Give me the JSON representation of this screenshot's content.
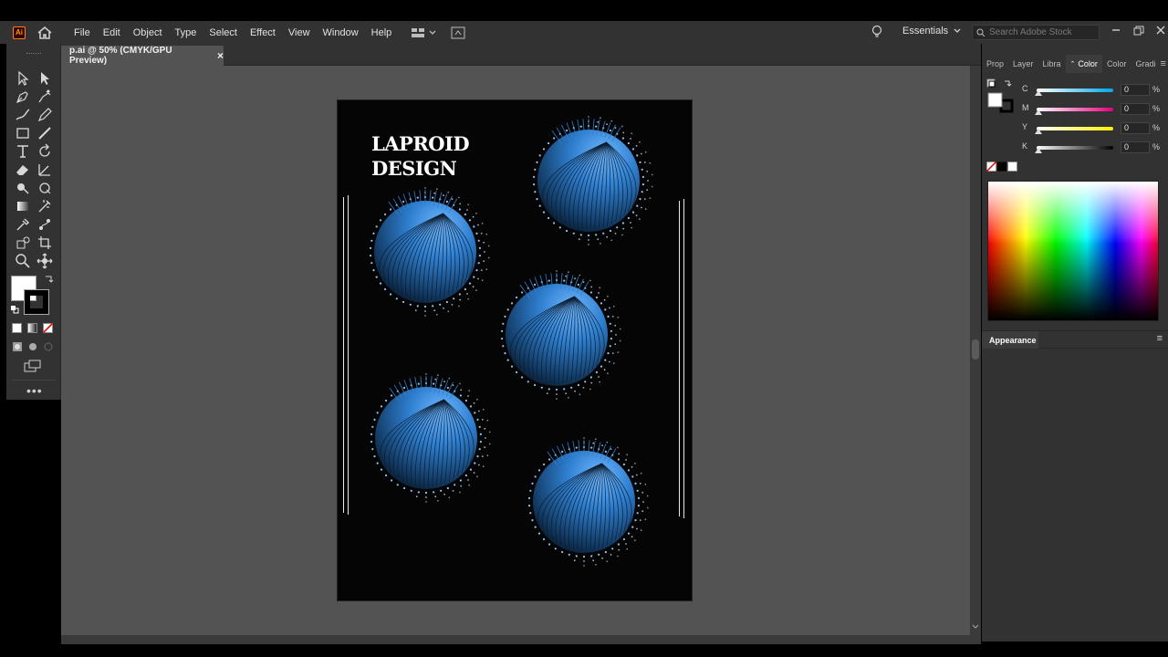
{
  "app": {
    "logo_text": "Ai"
  },
  "menu": [
    "File",
    "Edit",
    "Object",
    "Type",
    "Select",
    "Effect",
    "View",
    "Window",
    "Help"
  ],
  "workspace": {
    "label": "Essentials"
  },
  "search": {
    "placeholder": "Search Adobe Stock"
  },
  "document_tab": {
    "title": "p.ai @ 50% (CMYK/GPU Preview)",
    "close": "×"
  },
  "artwork": {
    "title_line1": "LAPROID",
    "title_line2": "DESIGN",
    "sphere_color": "#2f7fd0"
  },
  "panel_tabs": [
    "Prop",
    "Layer",
    "Libra",
    "Color",
    "Color",
    "Gradi"
  ],
  "color_panel": {
    "channels": [
      {
        "label": "C",
        "value": "0",
        "unit": "%",
        "color_from": "#ffffff",
        "color_to": "#00a6e8"
      },
      {
        "label": "M",
        "value": "0",
        "unit": "%",
        "color_from": "#ffffff",
        "color_to": "#e8007f"
      },
      {
        "label": "Y",
        "value": "0",
        "unit": "%",
        "color_from": "#ffffff",
        "color_to": "#ffee00"
      },
      {
        "label": "K",
        "value": "0",
        "unit": "%",
        "color_from": "#ffffff",
        "color_to": "#000000"
      }
    ]
  },
  "appearance_panel": {
    "title": "Appearance"
  },
  "colors": {
    "chrome": "#323232",
    "canvas": "#535353",
    "accent": "#ff9a00"
  }
}
